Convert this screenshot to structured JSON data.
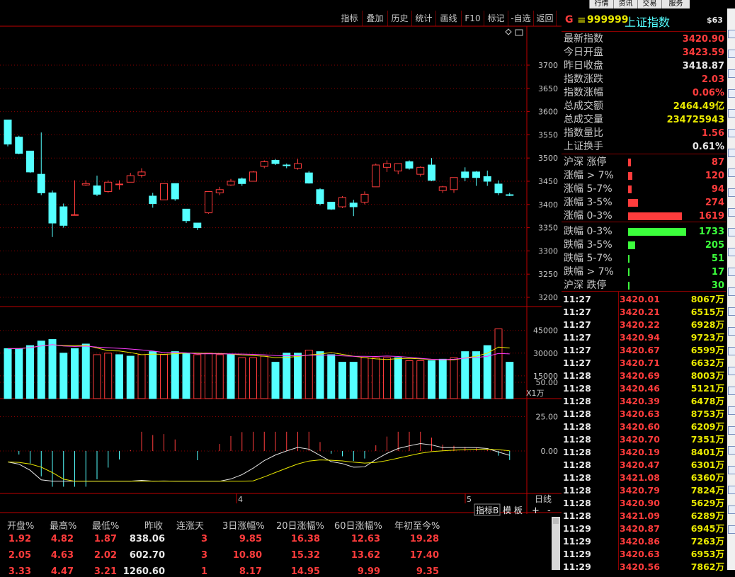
{
  "top_tabs": [
    "行情",
    "资讯",
    "交易",
    "服务"
  ],
  "toolbar": [
    "指标",
    "叠加",
    "历史",
    "统计",
    "画线",
    "F10",
    "标记",
    "-自选",
    "返回"
  ],
  "header": {
    "g_icon": "G",
    "menu_icon": "≡",
    "code": "999999",
    "name": "上证指数",
    "tag": "$63"
  },
  "stats": [
    {
      "label": "最新指数",
      "value": "3420.90",
      "color": "#ff3c3c"
    },
    {
      "label": "今日开盘",
      "value": "3423.59",
      "color": "#ff3c3c"
    },
    {
      "label": "昨日收盘",
      "value": "3418.87",
      "color": "#e8e8e8"
    },
    {
      "label": "指数涨跌",
      "value": "2.03",
      "color": "#ff3c3c"
    },
    {
      "label": "指数涨幅",
      "value": "0.06%",
      "color": "#ff3c3c"
    },
    {
      "label": "总成交额",
      "value": "2464.49亿",
      "color": "#e8e800"
    },
    {
      "label": "总成交量",
      "value": "234725943",
      "color": "#e8e800"
    },
    {
      "label": "指数量比",
      "value": "1.56",
      "color": "#ff3c3c"
    },
    {
      "label": "上证换手",
      "value": "0.61%",
      "color": "#e8e8e8"
    }
  ],
  "breadth": [
    {
      "label": "沪深 涨停",
      "value": "87",
      "color": "#ff3c3c",
      "fraction": 0.05
    },
    {
      "label": "涨幅 > 7%",
      "value": "120",
      "color": "#ff3c3c",
      "fraction": 0.07
    },
    {
      "label": "涨幅 5-7%",
      "value": "94",
      "color": "#ff3c3c",
      "fraction": 0.06
    },
    {
      "label": "涨幅 3-5%",
      "value": "274",
      "color": "#ff3c3c",
      "fraction": 0.17
    },
    {
      "label": "涨幅 0-3%",
      "value": "1619",
      "color": "#ff3c3c",
      "fraction": 0.93
    },
    {
      "label": "跌幅 0-3%",
      "value": "1733",
      "color": "#3cff3c",
      "fraction": 1.0
    },
    {
      "label": "跌幅 3-5%",
      "value": "205",
      "color": "#3cff3c",
      "fraction": 0.12
    },
    {
      "label": "跌幅 5-7%",
      "value": "51",
      "color": "#3cff3c",
      "fraction": 0.03
    },
    {
      "label": "跌幅 > 7%",
      "value": "17",
      "color": "#3cff3c",
      "fraction": 0.01
    },
    {
      "label": "沪深 跌停",
      "value": "30",
      "color": "#3cff3c",
      "fraction": 0.02
    }
  ],
  "ticks": [
    [
      "11:27",
      "3420.01",
      "8067万"
    ],
    [
      "11:27",
      "3420.21",
      "6515万"
    ],
    [
      "11:27",
      "3420.22",
      "6928万"
    ],
    [
      "11:27",
      "3420.94",
      "9723万"
    ],
    [
      "11:27",
      "3420.67",
      "6599万"
    ],
    [
      "11:27",
      "3420.71",
      "6632万"
    ],
    [
      "11:28",
      "3420.69",
      "8003万"
    ],
    [
      "11:28",
      "3420.46",
      "5121万"
    ],
    [
      "11:28",
      "3420.39",
      "6478万"
    ],
    [
      "11:28",
      "3420.63",
      "8753万"
    ],
    [
      "11:28",
      "3420.60",
      "6209万"
    ],
    [
      "11:28",
      "3420.70",
      "7351万"
    ],
    [
      "11:28",
      "3420.19",
      "8401万"
    ],
    [
      "11:28",
      "3420.47",
      "6301万"
    ],
    [
      "11:28",
      "3421.08",
      "6360万"
    ],
    [
      "11:28",
      "3420.79",
      "7824万"
    ],
    [
      "11:28",
      "3420.90",
      "5629万"
    ],
    [
      "11:28",
      "3421.09",
      "6289万"
    ],
    [
      "11:29",
      "3420.87",
      "6945万"
    ],
    [
      "11:29",
      "3420.86",
      "7263万"
    ],
    [
      "11:29",
      "3420.63",
      "6953万"
    ],
    [
      "11:29",
      "3420.56",
      "7862万"
    ]
  ],
  "bottom_table": {
    "headers": [
      "开盘%",
      "最高%",
      "最低%",
      "昨收",
      "连涨天",
      "3日涨幅%",
      "20日涨幅%",
      "60日涨幅%",
      "年初至今%"
    ],
    "rows": [
      [
        "1.92",
        "4.82",
        "1.87",
        "838.06",
        "3",
        "9.85",
        "16.38",
        "12.63",
        "19.28"
      ],
      [
        "2.05",
        "4.63",
        "2.02",
        "602.70",
        "3",
        "10.80",
        "15.32",
        "13.62",
        "17.40"
      ],
      [
        "3.33",
        "4.47",
        "3.21",
        "1260.60",
        "1",
        "8.17",
        "14.95",
        "9.99",
        "9.35"
      ]
    ]
  },
  "chart_labels": {
    "price_axis": [
      "3700",
      "3650",
      "3600",
      "3550",
      "3500",
      "3450",
      "3400",
      "3350",
      "3300",
      "3250",
      "3200"
    ],
    "volume_axis": [
      "45000",
      "30000",
      "15000"
    ],
    "volume_unit": "X1万",
    "macd_axis": [
      "50.00",
      "25.00",
      "0.00"
    ],
    "x_labels": [
      "4",
      "5"
    ],
    "period": "日线",
    "tab_indicator": "指标B",
    "tab_template": "模 板",
    "plus": "+",
    "minus": "-"
  },
  "chart_data": {
    "type": "candlestick",
    "ylim": [
      3200,
      3720
    ],
    "candles": [
      [
        3582,
        3582,
        3530,
        3525
      ],
      [
        3545,
        3548,
        3510,
        3508
      ],
      [
        3515,
        3515,
        3470,
        3468
      ],
      [
        3465,
        3555,
        3425,
        3420
      ],
      [
        3425,
        3430,
        3360,
        3330
      ],
      [
        3395,
        3402,
        3355,
        3350
      ],
      [
        3378,
        3452,
        3378,
        3378
      ],
      [
        3442,
        3452,
        3445,
        3440
      ],
      [
        3440,
        3462,
        3422,
        3418
      ],
      [
        3428,
        3452,
        3448,
        3425
      ],
      [
        3444,
        3452,
        3444,
        3432
      ],
      [
        3448,
        3468,
        3462,
        3452
      ],
      [
        3463,
        3478,
        3470,
        3458
      ],
      [
        3418,
        3425,
        3402,
        3393
      ],
      [
        3410,
        3445,
        3445,
        3410
      ],
      [
        3445,
        3445,
        3412,
        3408
      ],
      [
        3390,
        3390,
        3365,
        3360
      ],
      [
        3360,
        3360,
        3350,
        3345
      ],
      [
        3382,
        3428,
        3428,
        3380
      ],
      [
        3425,
        3438,
        3432,
        3420
      ],
      [
        3442,
        3455,
        3450,
        3440
      ],
      [
        3455,
        3458,
        3445,
        3440
      ],
      [
        3450,
        3472,
        3470,
        3450
      ],
      [
        3482,
        3495,
        3492,
        3478
      ],
      [
        3495,
        3498,
        3488,
        3485
      ],
      [
        3485,
        3488,
        3484,
        3478
      ],
      [
        3478,
        3498,
        3488,
        3475
      ],
      [
        3468,
        3472,
        3446,
        3445
      ],
      [
        3432,
        3435,
        3402,
        3398
      ],
      [
        3405,
        3405,
        3390,
        3388
      ],
      [
        3395,
        3418,
        3415,
        3392
      ],
      [
        3403,
        3410,
        3395,
        3375
      ],
      [
        3405,
        3428,
        3422,
        3400
      ],
      [
        3438,
        3488,
        3485,
        3438
      ],
      [
        3480,
        3495,
        3488,
        3470
      ],
      [
        3472,
        3488,
        3488,
        3465
      ],
      [
        3492,
        3495,
        3478,
        3475
      ],
      [
        3465,
        3482,
        3480,
        3460
      ],
      [
        3485,
        3500,
        3452,
        3450
      ],
      [
        3430,
        3440,
        3438,
        3425
      ],
      [
        3432,
        3458,
        3458,
        3425
      ],
      [
        3470,
        3480,
        3458,
        3450
      ],
      [
        3470,
        3472,
        3458,
        3440
      ],
      [
        3460,
        3473,
        3450,
        3440
      ],
      [
        3444,
        3452,
        3425,
        3420
      ],
      [
        3421,
        3425,
        3420,
        3418
      ]
    ],
    "volumes": [
      [
        33000,
        0
      ],
      [
        33000,
        0
      ],
      [
        35000,
        0
      ],
      [
        38000,
        0
      ],
      [
        39000,
        0
      ],
      [
        30000,
        0
      ],
      [
        33000,
        0
      ],
      [
        36000,
        0
      ],
      [
        29000,
        1
      ],
      [
        30000,
        1
      ],
      [
        29000,
        0
      ],
      [
        28000,
        0
      ],
      [
        29000,
        1
      ],
      [
        31000,
        0
      ],
      [
        29000,
        1
      ],
      [
        31000,
        0
      ],
      [
        30000,
        0
      ],
      [
        29000,
        1
      ],
      [
        30000,
        1
      ],
      [
        29000,
        1
      ],
      [
        29000,
        0
      ],
      [
        27000,
        1
      ],
      [
        27000,
        1
      ],
      [
        28000,
        1
      ],
      [
        24000,
        0
      ],
      [
        30000,
        0
      ],
      [
        30000,
        0
      ],
      [
        32000,
        1
      ],
      [
        31000,
        0
      ],
      [
        29000,
        0
      ],
      [
        24000,
        0
      ],
      [
        24000,
        0
      ],
      [
        27000,
        1
      ],
      [
        27000,
        1
      ],
      [
        27000,
        1
      ],
      [
        27000,
        0
      ],
      [
        25000,
        1
      ],
      [
        25000,
        1
      ],
      [
        25000,
        0
      ],
      [
        26000,
        0
      ],
      [
        27000,
        1
      ],
      [
        31000,
        0
      ],
      [
        31000,
        0
      ],
      [
        35000,
        0
      ],
      [
        46000,
        1
      ],
      [
        24000,
        0
      ]
    ],
    "volume_ylim": [
      0,
      50000
    ],
    "macd_ylim": [
      -27,
      55
    ]
  },
  "colors": {
    "up": "#ff3c3c",
    "down": "#54ffff",
    "grid": "#8a0000",
    "axis": "#c00000",
    "ma1": "#e8e8e8",
    "ma2": "#e8e800",
    "ma3": "#ff3cff"
  }
}
